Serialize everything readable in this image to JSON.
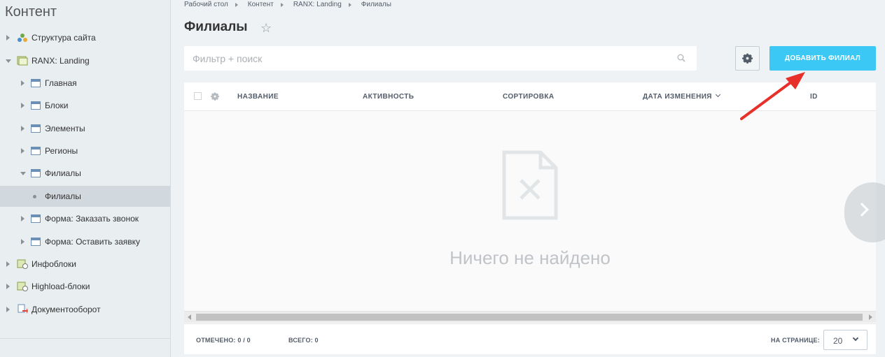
{
  "sidebar": {
    "title": "Контент",
    "items": [
      {
        "label": "Структура сайта"
      },
      {
        "label": "RANX: Landing"
      },
      {
        "label": "Главная"
      },
      {
        "label": "Блоки"
      },
      {
        "label": "Элементы"
      },
      {
        "label": "Регионы"
      },
      {
        "label": "Филиалы"
      },
      {
        "label": "Филиалы"
      },
      {
        "label": "Форма: Заказать звонок"
      },
      {
        "label": "Форма: Оставить заявку"
      },
      {
        "label": "Инфоблоки"
      },
      {
        "label": "Highload-блоки"
      },
      {
        "label": "Документооборот"
      }
    ]
  },
  "breadcrumb": [
    "Рабочий стол",
    "Контент",
    "RANX: Landing",
    "Филиалы"
  ],
  "page": {
    "title": "Филиалы"
  },
  "search": {
    "placeholder": "Фильтр + поиск"
  },
  "toolbar": {
    "add_label": "ДОБАВИТЬ ФИЛИАЛ"
  },
  "grid": {
    "columns": [
      "НАЗВАНИЕ",
      "АКТИВНОСТЬ",
      "СОРТИРОВКА",
      "ДАТА ИЗМЕНЕНИЯ",
      "ID"
    ],
    "empty_text": "Ничего не найдено"
  },
  "footer": {
    "selected_label": "ОТМЕЧЕНО:",
    "selected_value": "0 / 0",
    "total_label": "ВСЕГО:",
    "total_value": "0",
    "per_page_label": "НА СТРАНИЦЕ:",
    "per_page_value": "20"
  },
  "colors": {
    "accent": "#3bc8f5",
    "annotation": "#e8302b"
  }
}
